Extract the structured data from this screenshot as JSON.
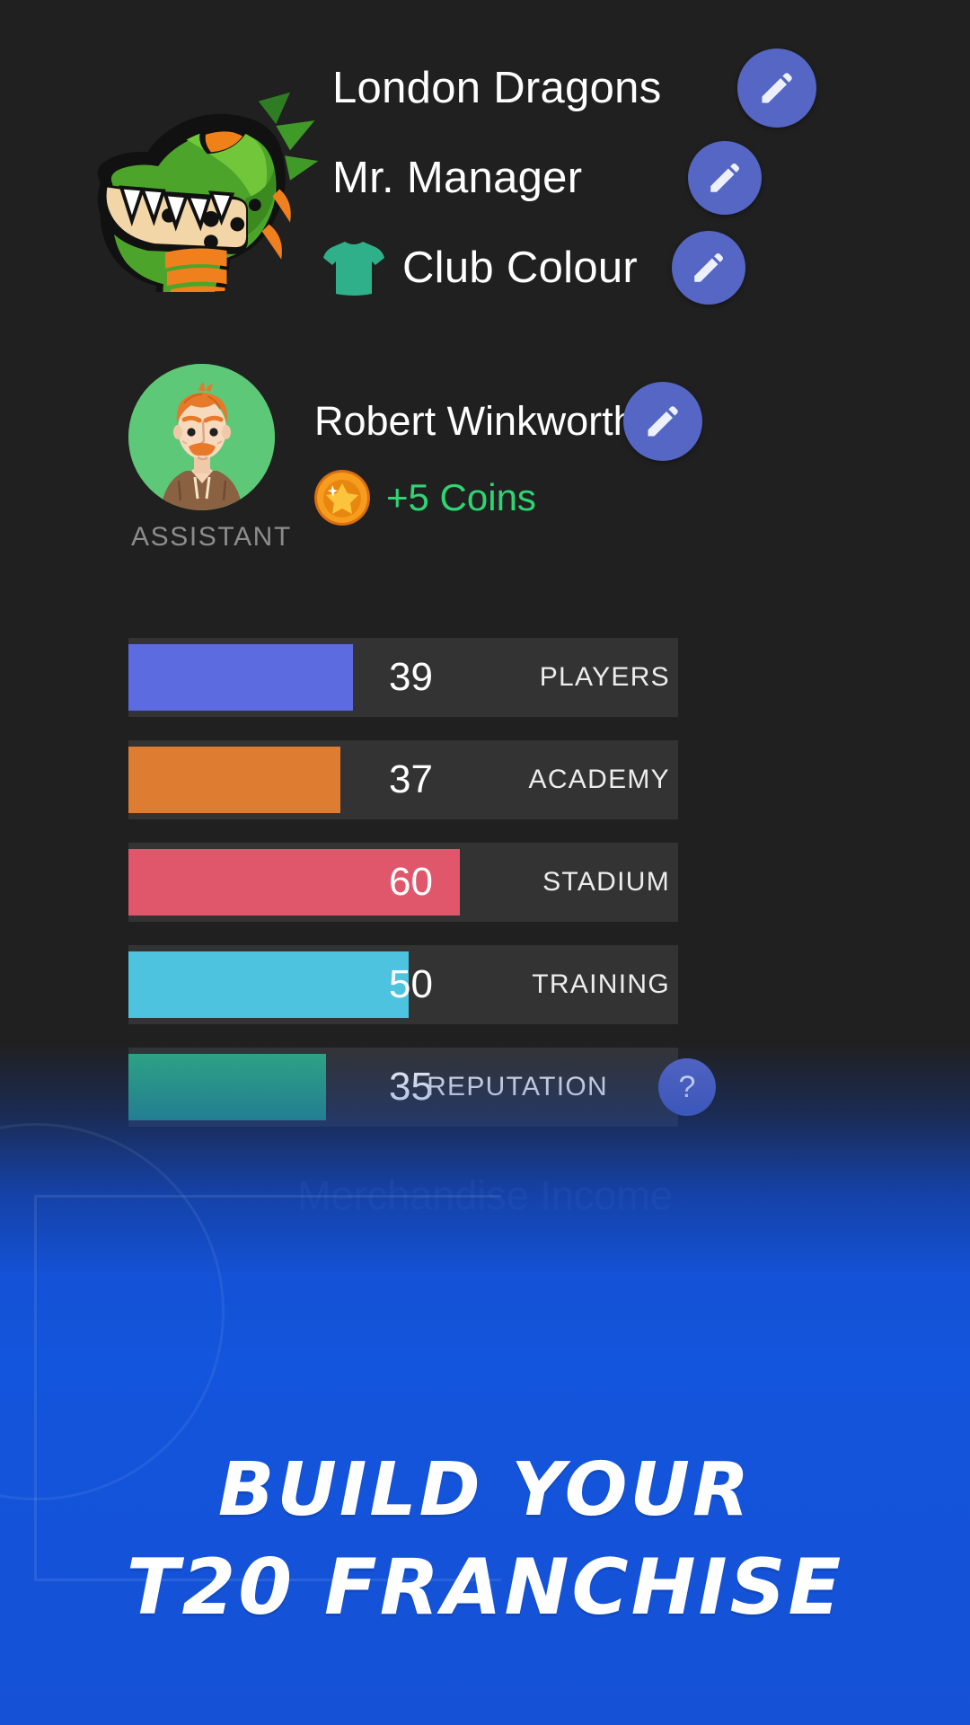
{
  "club": {
    "logo_icon": "dragon-head-logo",
    "name": "London Dragons",
    "manager": "Mr. Manager",
    "colour_label": "Club Colour",
    "colour_hex": "#2fb08a",
    "edit_icon": "pencil-icon",
    "shirt_icon": "tshirt-icon"
  },
  "assistant": {
    "avatar_icon": "assistant-avatar",
    "name": "Robert Winkworth",
    "coin_icon": "coin-star-icon",
    "coins_text": "+5 Coins",
    "coins_color": "#2fd573",
    "role_label": "ASSISTANT",
    "edit_icon": "pencil-icon"
  },
  "chart_data": {
    "type": "bar",
    "title": "",
    "xlabel": "",
    "ylabel": "",
    "xlim": [
      0,
      100
    ],
    "grid": false,
    "legend": "none",
    "orientation": "horizontal",
    "categories": [
      "PLAYERS",
      "ACADEMY",
      "STADIUM",
      "TRAINING",
      "REPUTATION"
    ],
    "values": [
      39,
      37,
      60,
      50,
      35
    ],
    "colors": [
      "#5c6be0",
      "#de7c32",
      "#e0566a",
      "#4ec3e0",
      "#2fa882"
    ],
    "track_color": "#333333"
  },
  "stats": [
    {
      "value": "39",
      "name": "PLAYERS",
      "pct": 40.8,
      "color": "#5c6be0",
      "help": false
    },
    {
      "value": "37",
      "name": "ACADEMY",
      "pct": 38.6,
      "color": "#de7c32",
      "help": false
    },
    {
      "value": "60",
      "name": "STADIUM",
      "pct": 60.3,
      "color": "#e0566a",
      "help": false
    },
    {
      "value": "50",
      "name": "TRAINING",
      "pct": 51.0,
      "color": "#4ec3e0",
      "help": false
    },
    {
      "value": "35",
      "name": "REPUTATION",
      "pct": 36.0,
      "color": "#2fa882",
      "help": true
    }
  ],
  "help_button_label": "?",
  "background_text": "Merchandise Income",
  "promo": {
    "line1": "BUILD YOUR",
    "line2": "T20 FRANCHISE",
    "background_color": "#1355dc"
  }
}
